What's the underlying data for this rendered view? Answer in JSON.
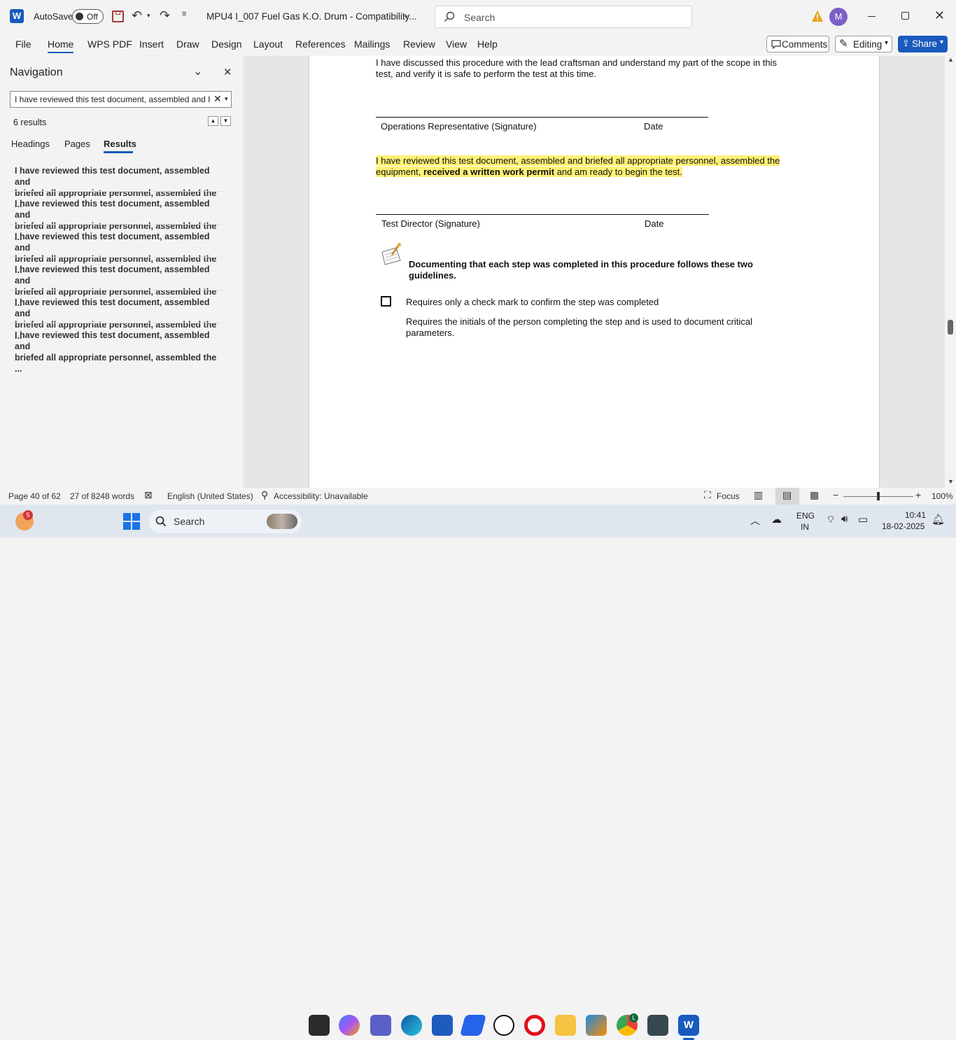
{
  "titlebar": {
    "autosave_label": "AutoSave",
    "autosave_state": "Off",
    "doc_title": "MPU4 I_007 Fuel Gas K.O. Drum  -  Compatibility...",
    "search_placeholder": "Search",
    "avatar_initial": "M"
  },
  "ribbon": {
    "tabs": [
      "File",
      "Home",
      "WPS PDF",
      "Insert",
      "Draw",
      "Design",
      "Layout",
      "References",
      "Mailings",
      "Review",
      "View",
      "Help"
    ],
    "comments_label": "Comments",
    "editing_label": "Editing",
    "share_label": "Share"
  },
  "navigation": {
    "title": "Navigation",
    "search_value": "I have reviewed this test document, assembled and I",
    "results_count": "6 results",
    "tabs": [
      "Headings",
      "Pages",
      "Results"
    ],
    "results": [
      {
        "line1": "I have reviewed this test document, assembled and",
        "line2": "briefed all appropriate personnel, assembled the ..."
      },
      {
        "line1": "I have reviewed this test document, assembled and",
        "line2": "briefed all appropriate personnel, assembled the ..."
      },
      {
        "line1": "I have reviewed this test document, assembled and",
        "line2": "briefed all appropriate personnel, assembled the ..."
      },
      {
        "line1": "I have reviewed this test document, assembled and",
        "line2": "briefed all appropriate personnel, assembled the ..."
      },
      {
        "line1": "I have reviewed this test document, assembled and",
        "line2": "briefed all appropriate personnel, assembled the ..."
      },
      {
        "line1": "I have reviewed this test document, assembled and",
        "line2": "briefed all appropriate personnel, assembled the ..."
      }
    ]
  },
  "document": {
    "para1_line1": "I have discussed this procedure with the lead craftsman and understand my part of the scope in this",
    "para1_line2": "test, and verify it is safe to perform the test at this time.",
    "sig1_label": "Operations Representative (Signature)",
    "sig1_date": "Date",
    "para2_line1": "I have reviewed this test document, assembled and briefed all appropriate personnel, assembled the",
    "para2_line2a": "equipment, ",
    "para2_line2b": "received a written work permit",
    "para2_line2c": " and am ready to begin the test.",
    "sig2_label": "Test Director (Signature)",
    "sig2_date": "Date",
    "note_line1": "Documenting that each step was completed in this procedure follows these two",
    "note_line2": "guidelines.",
    "guideline1": "Requires only a check mark to confirm the step was completed",
    "guideline2_line1": "Requires the initials of the person completing the step and is used to document critical",
    "guideline2_line2": "parameters."
  },
  "statusbar": {
    "page": "Page 40 of 62",
    "words": "27 of 8248 words",
    "language": "English (United States)",
    "accessibility": "Accessibility: Unavailable",
    "focus": "Focus",
    "zoom": "100%",
    "zoom_level": 0.5
  },
  "taskbar": {
    "weather_badge": "5",
    "search_label": "Search",
    "chrome_badge": "L",
    "lang_line1": "ENG",
    "lang_line2": "IN",
    "time": "10:41",
    "date": "18-02-2025"
  },
  "colors": {
    "accent": "#185abd",
    "highlight": "#fff176",
    "warning": "#e8a317"
  }
}
